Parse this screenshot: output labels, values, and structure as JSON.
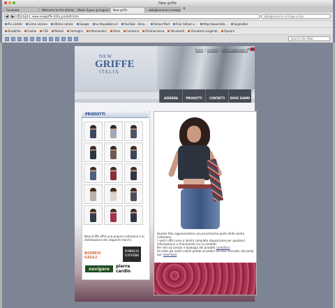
{
  "browser": {
    "window_title": "New griffe",
    "tabs": [
      {
        "label": "Facebook"
      },
      {
        "label": "Welcome to the ultimate designe..."
      },
      {
        "label": "Motor Super @ Legends of Betr..."
      },
      {
        "label": "New griffe"
      },
      {
        "label": "abbigliamento vintage prato"
      }
    ],
    "url": "www.newgriffe.it/ita_prodotti.htm",
    "search_placeholder": "abbigliamento vintage prato",
    "bookmarks": [
      "Più visitati",
      "Come iniziare",
      "Ultime notizie",
      "Google",
      "La Repubblica.it",
      "YouTube - Broa...",
      "Fallout Mod",
      "Free Fallout v...",
      "http://www.fallo...",
      "Segnalibri"
    ],
    "bookmarks2": [
      "Disabilita",
      "Cookie",
      "CSS",
      "Moduli",
      "Immagini",
      "Informazioni",
      "Varie",
      "Contorno",
      "Ridimensiona",
      "Strumenti",
      "Visualizza sorgente",
      "Opzioni"
    ],
    "toolbar_search": "Search the Web"
  },
  "site": {
    "logo": {
      "top": "NEW",
      "middle": "GRIFFE",
      "bottom": "ITALIA"
    },
    "top_links": [
      "home",
      "contatti",
      "come raggiungerci"
    ],
    "menu": [
      "AZIENDA",
      "PRODOTTI",
      "CONTATTI",
      "DOVE SIAMO"
    ],
    "products_title": "PRODOTTI",
    "products_text": "New Griffe offre una propria collezione e la distribuzione dei seguenti marchi:",
    "brands": {
      "romeo": "ROMEO GIGLI",
      "enrico_line1": "ENRICO",
      "enrico_line2": "COVERI",
      "navigare": "navigare",
      "cardin": "pierre cardin"
    },
    "hero_text_1": "Queste foto rappresentano una piccolissima parte della nostra collezione.",
    "hero_text_2": "I nostri uffici sono a Vostra completa disposizione per qualsiasi informazione o chiarimento sui ns prodotti.",
    "hero_text_3": "Per info sul prezzo e tipologia dei prodotti",
    "hero_link_contact": "contattaci",
    "hero_text_4": "Se siete già nostri clienti potete accedere all'area riservata cliccando qui:",
    "hero_link_download": "download"
  }
}
